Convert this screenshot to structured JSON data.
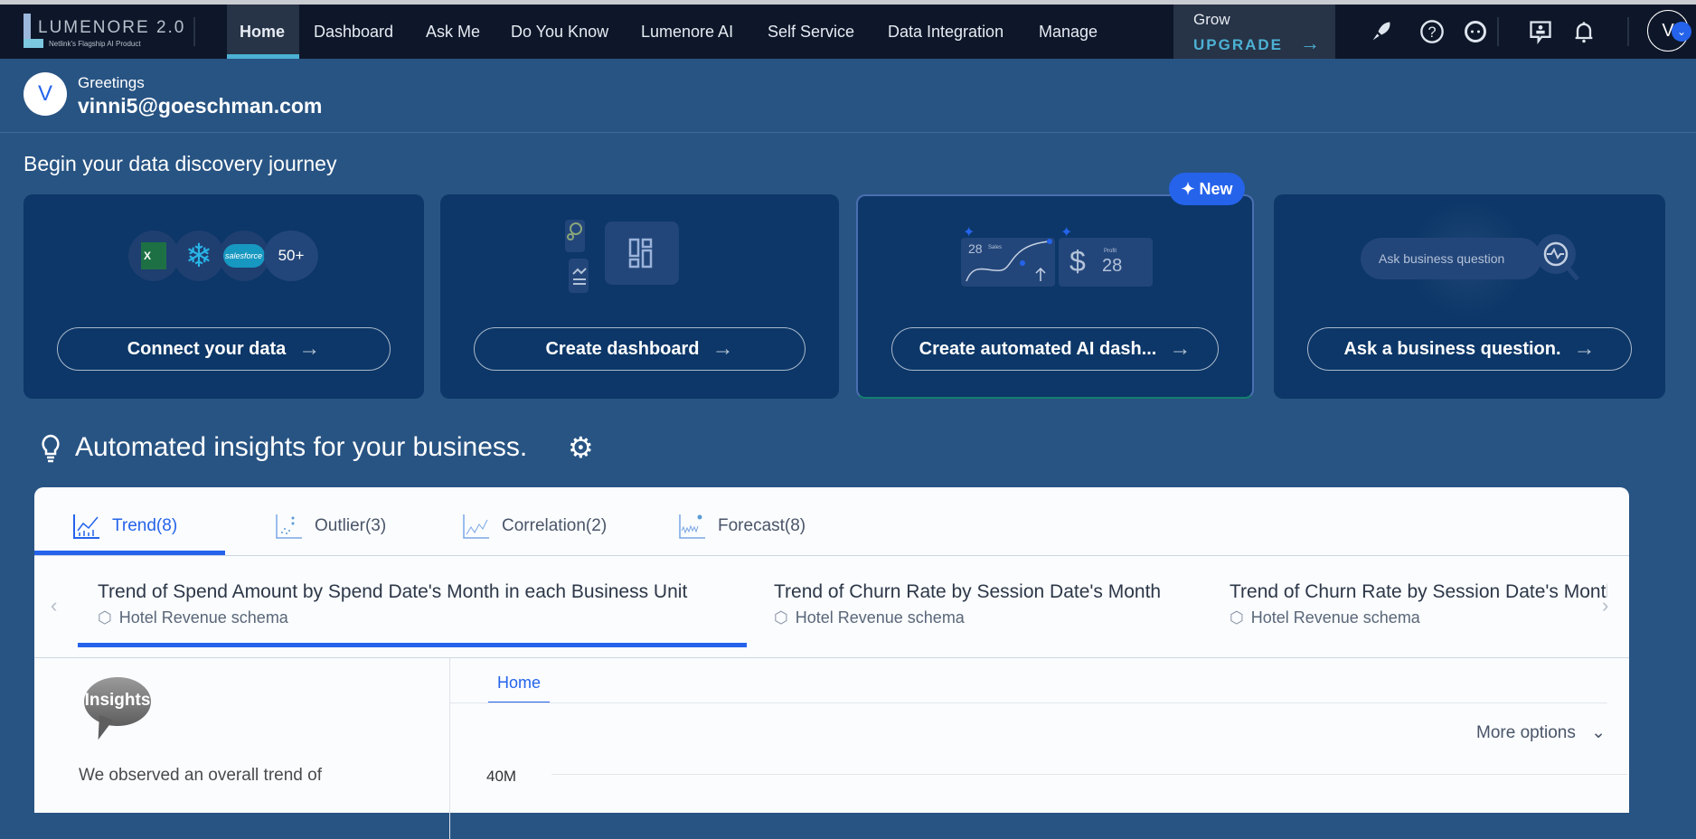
{
  "nav": {
    "logo_text": "LUMENORE 2.0",
    "logo_tagline": "Netlink's Flagship AI Product",
    "items": [
      "Home",
      "Dashboard",
      "Ask Me",
      "Do You Know",
      "Lumenore AI",
      "Self Service",
      "Data Integration",
      "Manage"
    ],
    "active": "Home",
    "grow_label": "Grow",
    "upgrade_label": "UPGRADE",
    "avatar_initial": "V",
    "icons": [
      "rocket-icon",
      "help-icon",
      "support-agent-icon",
      "feedback-icon",
      "bell-icon"
    ]
  },
  "greeting": {
    "avatar_initial": "V",
    "label": "Greetings",
    "email": "vinni5@goeschman.com"
  },
  "journey": {
    "title": "Begin your data discovery journey",
    "cards": [
      {
        "button": "Connect your data",
        "more_label": "50+",
        "logos": [
          "excel",
          "snowflake",
          "salesforce"
        ],
        "salesforce_text": "salesforce"
      },
      {
        "button": "Create dashboard"
      },
      {
        "button": "Create automated AI dash...",
        "badge": "New",
        "sales_value": "28",
        "sales_label": "Sales",
        "profit_value": "28",
        "profit_label": "Profit",
        "currency": "$"
      },
      {
        "button": "Ask a business question.",
        "search_placeholder": "Ask business question"
      }
    ]
  },
  "insights": {
    "title": "Automated insights for your business.",
    "tabs": [
      {
        "label": "Trend(8)",
        "active": true
      },
      {
        "label": "Outlier(3)"
      },
      {
        "label": "Correlation(2)"
      },
      {
        "label": "Forecast(8)"
      }
    ],
    "cards": [
      {
        "title": "Trend of Spend Amount by Spend Date's Month in each Business Unit",
        "schema": "Hotel Revenue schema",
        "active": true
      },
      {
        "title": "Trend of Churn Rate by Session Date's Month",
        "schema": "Hotel Revenue schema"
      },
      {
        "title": "Trend of Churn Rate by Session Date's Month",
        "schema": "Hotel Revenue schema"
      }
    ],
    "bubble_text": "Insights",
    "summary": "We observed an overall trend of",
    "chart_tab": "Home",
    "more_options": "More options",
    "y_tick": "40M"
  },
  "colors": {
    "nav_bg": "#0e1729",
    "page_bg": "#285483",
    "card_bg": "#0c3768",
    "accent": "#2563eb",
    "upgrade": "#4cb1d4"
  }
}
